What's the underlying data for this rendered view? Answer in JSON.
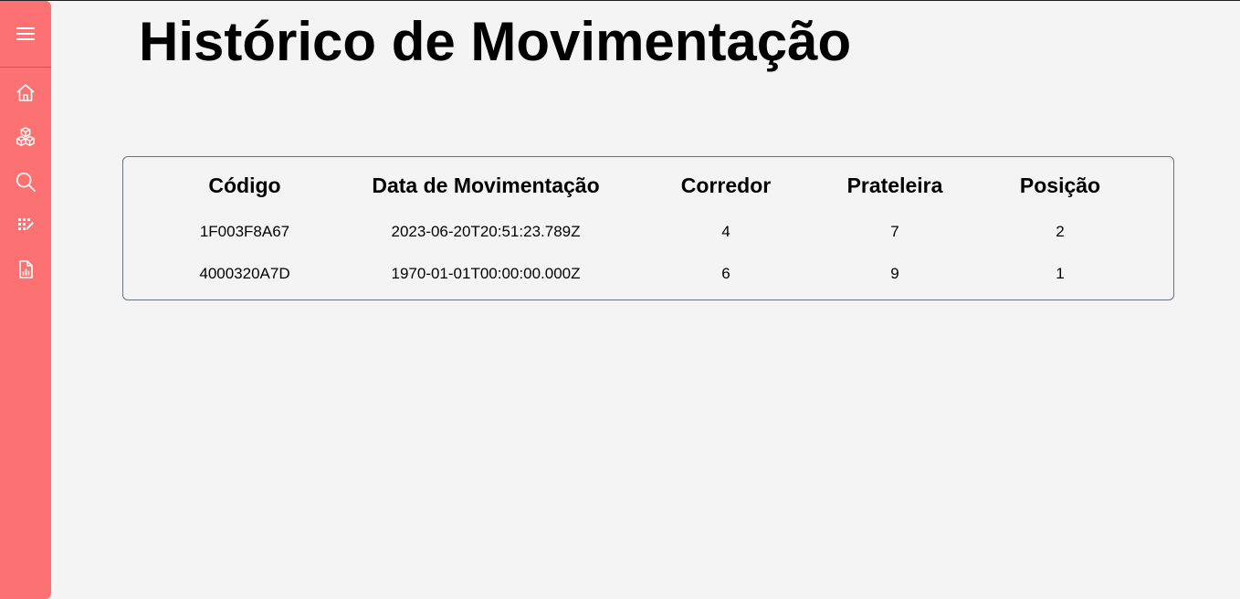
{
  "page": {
    "title": "Histórico de Movimentação"
  },
  "sidebar": {
    "background": "#fc7272",
    "items": [
      {
        "icon": "menu-icon"
      },
      {
        "icon": "home-icon"
      },
      {
        "icon": "boxes-icon"
      },
      {
        "icon": "search-icon"
      },
      {
        "icon": "scan-edit-icon"
      },
      {
        "icon": "report-icon"
      }
    ]
  },
  "table": {
    "headers": [
      "Código",
      "Data de Movimentação",
      "Corredor",
      "Prateleira",
      "Posição"
    ],
    "rows": [
      [
        "1F003F8A67",
        "2023-06-20T20:51:23.789Z",
        "4",
        "7",
        "2"
      ],
      [
        "4000320A7D",
        "1970-01-01T00:00:00.000Z",
        "6",
        "9",
        "1"
      ]
    ]
  }
}
